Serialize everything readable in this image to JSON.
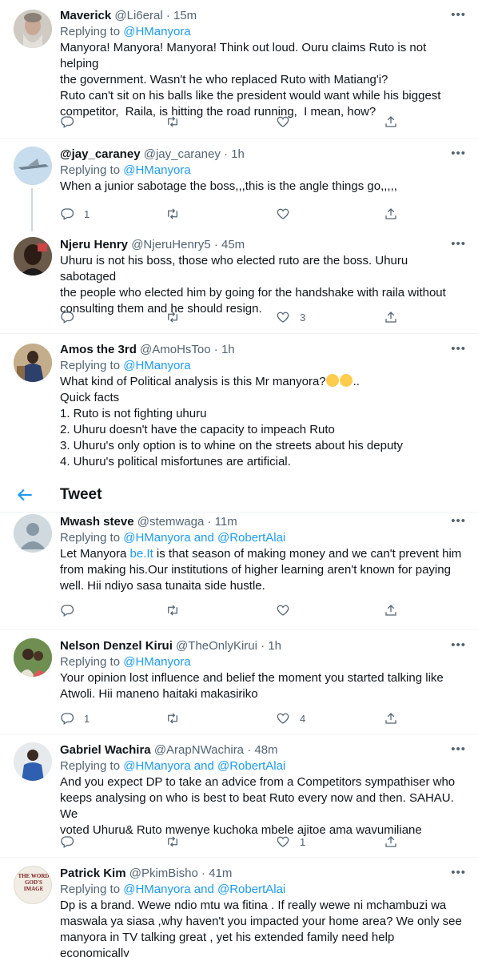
{
  "header": {
    "title": "Tweet",
    "back_label": "back"
  },
  "icons": {
    "reply": "reply-icon",
    "retweet": "retweet-icon",
    "like": "heart-icon",
    "share": "share-icon",
    "more": "more-icon",
    "back": "back-arrow-icon"
  },
  "tweets": [
    {
      "name": "Maverick",
      "handle": "@Li6eral",
      "time": "15m",
      "replying_prefix": "Replying to ",
      "mentions": "@HManyora",
      "text": "Manyora! Manyora! Manyora! Think out loud. Ouru claims Ruto is not helping\nthe government. Wasn't he who replaced Ruto with Matiang'i?\nRuto can't sit on his balls like the president would want while his biggest\ncompetitor,  Raila, is hitting the road running,  I mean, how?",
      "reply_count": "",
      "retweet_count": "",
      "like_count": ""
    },
    {
      "name": "@jay_caraney",
      "handle": "@jay_caraney",
      "time": "1h",
      "replying_prefix": "Replying to ",
      "mentions": "@HManyora",
      "text": "When a junior sabotage the boss,,,this is the angle things go,,,,,",
      "reply_count": "1",
      "retweet_count": "",
      "like_count": ""
    },
    {
      "name": "Njeru Henry",
      "handle": "@NjeruHenry5",
      "time": "45m",
      "text": "Uhuru is not his boss, those who elected ruto are the boss. Uhuru sabotaged\nthe people who elected him by going for the handshake with raila without\nconsulting them and he should resign.",
      "reply_count": "",
      "retweet_count": "",
      "like_count": "3"
    },
    {
      "name": "Amos the 3rd",
      "handle": "@AmoHsToo",
      "time": "1h",
      "replying_prefix": "Replying to ",
      "mentions": "@HManyora",
      "text_before_emoji": "What kind of Political analysis is this Mr manyora?",
      "text_after_emoji": "..",
      "text": "Quick facts\n1. Ruto is not fighting uhuru\n2. Uhuru doesn't have the capacity to impeach Ruto\n3. Uhuru's only option is to whine on the streets about his deputy\n4. Uhuru's political misfortunes are artificial."
    },
    {
      "name": "Mwash steve",
      "handle": "@stemwaga",
      "time": "11m",
      "replying_prefix": "Replying to ",
      "mentions": "@HManyora and @RobertAlai",
      "text_prefix": "Let Manyora ",
      "text_link": "be.It",
      "text": " is that season of making money and we can't prevent him\nfrom making his.Our institutions of higher learning aren't known for paying\nwell. Hii ndiyo sasa tunaita side hustle.",
      "reply_count": "",
      "retweet_count": "",
      "like_count": ""
    },
    {
      "name": "Nelson Denzel Kirui",
      "handle": "@TheOnlyKirui",
      "time": "1h",
      "replying_prefix": "Replying to ",
      "mentions": "@HManyora",
      "text": "Your opinion lost influence and belief the moment you started talking like\nAtwoli. Hii maneno haitaki makasiriko",
      "reply_count": "1",
      "retweet_count": "",
      "like_count": "4"
    },
    {
      "name": "Gabriel Wachira",
      "handle": "@ArapNWachira",
      "time": "48m",
      "replying_prefix": "Replying to ",
      "mentions": "@HManyora and @RobertAlai",
      "text": "And you expect DP to take an advice from a Competitors sympathiser who\nkeeps analysing on who is best to beat Ruto every now and then. SAHAU. We\nvoted Uhuru& Ruto mwenye kuchoka mbele ajitoe ama wavumiliane",
      "reply_count": "",
      "retweet_count": "",
      "like_count": "1"
    },
    {
      "name": "Patrick Kim",
      "handle": "@PkimBisho",
      "time": "41m",
      "replying_prefix": "Replying to ",
      "mentions": "@HManyora and @RobertAlai",
      "text": "Dp is a brand. Wewe ndio mtu wa fitina . If really wewe ni mchambuzi wa\nmaswala ya siasa ,why haven't you impacted your home area? We only see\nmanyora in TV talking great , yet his extended family need help economically",
      "avatar_text": "THE WORD GOD'S IMAGE"
    }
  ],
  "colors": {
    "accent": "#1d9bf0",
    "secondary_text": "#536471",
    "separator": "#eff3f4"
  }
}
